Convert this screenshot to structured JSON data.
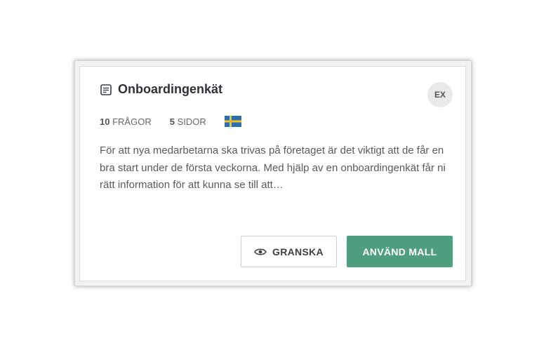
{
  "card": {
    "title": "Onboardingenkät",
    "badge": "EX",
    "meta": {
      "questions_count": "10",
      "questions_label": "FRÅGOR",
      "pages_count": "5",
      "pages_label": "SIDOR",
      "flag_icon": "sweden-flag-icon"
    },
    "description": "För att nya medarbetarna ska trivas på företaget är det viktigt att de får en bra start under de första veckorna. Med hjälp av en onboardingenkät får ni rätt information för att kunna se till att…",
    "review_button": "GRANSKA",
    "use_button": "ANVÄND MALL"
  },
  "colors": {
    "accent": "#4f9e7e",
    "flag_blue": "#2a6fb0",
    "flag_yellow": "#f2c21a"
  }
}
